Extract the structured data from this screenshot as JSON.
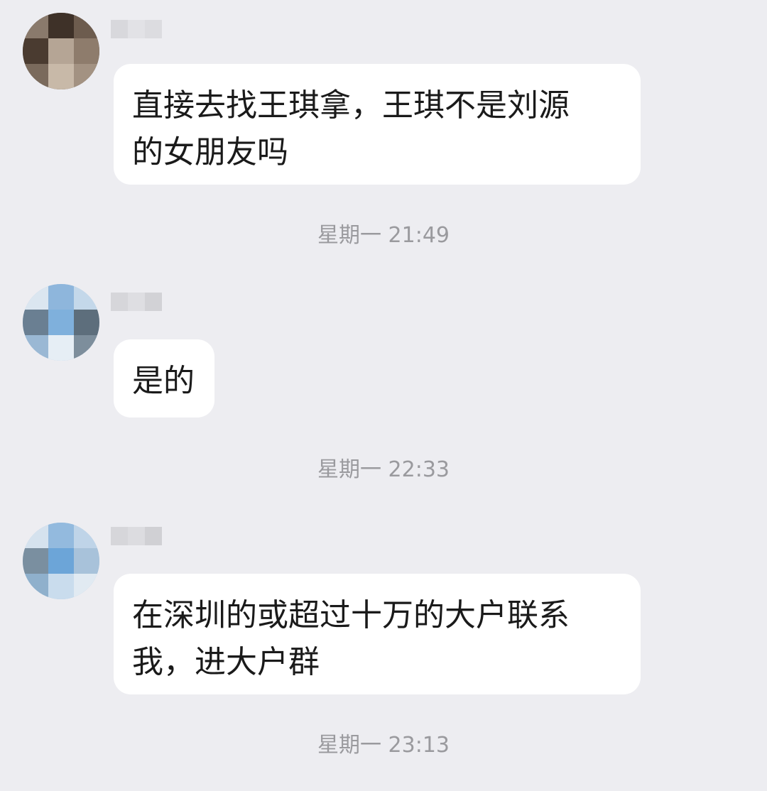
{
  "messages": [
    {
      "sender_name_blurred": true,
      "avatar": "blurred-avatar-dark",
      "text": "直接去找王琪拿，王琪不是刘源\n的女朋友吗"
    },
    {
      "sender_name_blurred": true,
      "avatar": "blurred-avatar-blue",
      "text": "是的"
    },
    {
      "sender_name_blurred": true,
      "avatar": "blurred-avatar-blue",
      "text": "在深圳的或超过十万的大户联系\n我，进大户群"
    }
  ],
  "timestamps": [
    "星期一 21:49",
    "星期一 22:33",
    "星期一 23:13"
  ],
  "colors": {
    "background": "#ededf1",
    "bubble": "#ffffff",
    "text": "#1a1a1a",
    "timestamp": "#9a9a9e"
  }
}
